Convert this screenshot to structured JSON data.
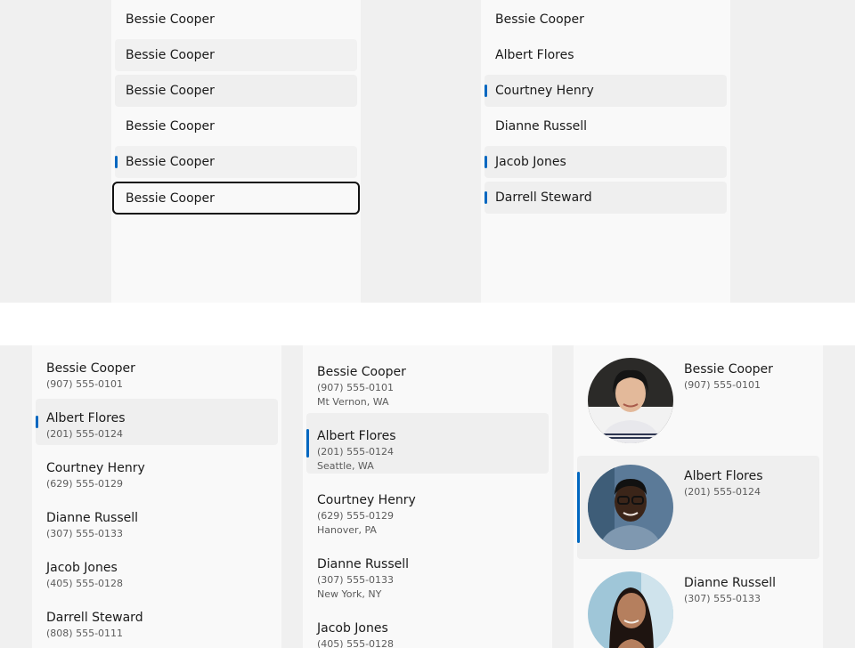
{
  "simple_list_1": {
    "items": [
      {
        "name": "Bessie Cooper",
        "state": "normal"
      },
      {
        "name": "Bessie Cooper",
        "state": "hover"
      },
      {
        "name": "Bessie Cooper",
        "state": "pressed"
      },
      {
        "name": "Bessie Cooper",
        "state": "normal"
      },
      {
        "name": "Bessie Cooper",
        "state": "selected"
      },
      {
        "name": "Bessie Cooper",
        "state": "focused"
      }
    ]
  },
  "simple_list_2": {
    "items": [
      {
        "name": "Bessie Cooper",
        "state": "normal"
      },
      {
        "name": "Albert Flores",
        "state": "normal"
      },
      {
        "name": "Courtney Henry",
        "state": "selected"
      },
      {
        "name": "Dianne Russell",
        "state": "normal"
      },
      {
        "name": "Jacob Jones",
        "state": "selected"
      },
      {
        "name": "Darrell Steward",
        "state": "selected"
      }
    ]
  },
  "contact_list": {
    "items": [
      {
        "name": "Bessie Cooper",
        "phone": "(907) 555-0101"
      },
      {
        "name": "Albert Flores",
        "phone": "(201) 555-0124"
      },
      {
        "name": "Courtney Henry",
        "phone": "(629) 555-0129"
      },
      {
        "name": "Dianne Russell",
        "phone": "(307) 555-0133"
      },
      {
        "name": "Jacob Jones",
        "phone": "(405) 555-0128"
      },
      {
        "name": "Darrell Steward",
        "phone": "(808) 555-0111"
      }
    ]
  },
  "detail_list": {
    "items": [
      {
        "name": "Bessie Cooper",
        "phone": "(907) 555-0101",
        "location": "Mt Vernon, WA"
      },
      {
        "name": "Albert Flores",
        "phone": "(201) 555-0124",
        "location": "Seattle, WA"
      },
      {
        "name": "Courtney Henry",
        "phone": "(629) 555-0129",
        "location": "Hanover, PA"
      },
      {
        "name": "Dianne Russell",
        "phone": "(307) 555-0133",
        "location": "New York, NY"
      },
      {
        "name": "Jacob Jones",
        "phone": "(405) 555-0128",
        "location": ""
      }
    ]
  },
  "avatar_list": {
    "items": [
      {
        "name": "Bessie Cooper",
        "phone": "(907) 555-0101",
        "avatar": "person-photo"
      },
      {
        "name": "Albert Flores",
        "phone": "(201) 555-0124",
        "avatar": "person-photo"
      },
      {
        "name": "Dianne Russell",
        "phone": "(307) 555-0133",
        "avatar": "person-photo"
      }
    ]
  },
  "colors": {
    "accent": "#0067c0",
    "pane": "#f9f9f9",
    "selected": "#efefef"
  }
}
